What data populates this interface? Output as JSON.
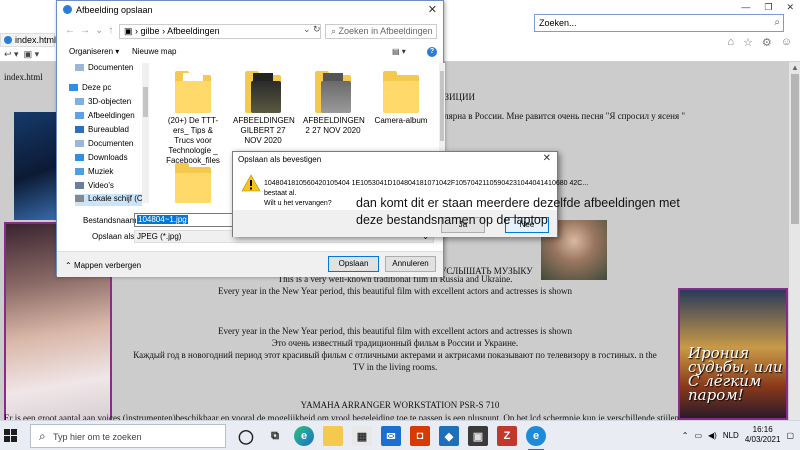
{
  "browser": {
    "tab_title": "index.html",
    "search_placeholder": "Zoeken...",
    "window_controls": [
      "—",
      "❐",
      "✕"
    ]
  },
  "page": {
    "filename_text": "index.html",
    "heading1": "ВИЗИЦИИ",
    "russian_line": "улярна в России. Мне равится очень песня \"Я спросил у ясеня \"",
    "heading2": "УСЛЫШАТЬ МУЗЫКУ",
    "para1": [
      "This is a very well-known traditional film in Russia and Ukraine.",
      "Every year in the New Year period, this beautiful film with excellent actors and actresses is shown"
    ],
    "para2": [
      "Every year in the New Year period, this beautiful film with excellent actors and actresses is shown",
      "Это очень известный традиционный фильм в России и Украине.",
      "Каждый год в новогодний период этот красивый фильм с отличными актерами и актрисами показывают по телевизору в гостиных. n the TV in the living rooms."
    ],
    "heading3": "YAMAHA ARRANGER WORKSTATION PSR-S 710",
    "last_line": "Er is een groot aantal aan voices (instrumenten)beschikbaar en vooral de mogelijkheid om vrool begeleiding toe te passen is een pluspunt. Op het lcd schermpje kun je verschillende stijlen",
    "poster_text": "Ирония судьбы, или С лёгким паром!"
  },
  "save_dialog": {
    "title": "Afbeelding opslaan",
    "path_segments": [
      "gilbe",
      "Afbeeldingen"
    ],
    "search_placeholder": "Zoeken in Afbeeldingen",
    "organise_label": "Organiseren ▾",
    "new_folder_label": "Nieuwe map",
    "tree": [
      "Documenten",
      "Deze pc",
      "3D-objecten",
      "Afbeeldingen",
      "Bureaublad",
      "Documenten",
      "Downloads",
      "Muziek",
      "Video's",
      "Lokale schijf (C:)"
    ],
    "files": [
      {
        "name": "(20+) De TTT-ers_ Tips & Trucs voor Technologie _ Facebook_files",
        "kind": "folder"
      },
      {
        "name": "AFBEELDINGEN GILBERT 27 NOV 2020",
        "kind": "folder-dark"
      },
      {
        "name": "AFBEELDINGEN 2 27 NOV 2020",
        "kind": "folder-grey"
      },
      {
        "name": "Camera-album",
        "kind": "folder"
      },
      {
        "name": "",
        "kind": "folder"
      }
    ],
    "filename_label": "Bestandsnaam:",
    "filename_value": "104804~1.jpg",
    "savetype_label": "Opslaan als:",
    "savetype_value": "JPEG (*.jpg)",
    "hide_folders_label": "Mappen verbergen",
    "save_button": "Opslaan",
    "cancel_button": "Annuleren"
  },
  "confirm_dialog": {
    "title": "Opslaan als bevestigen",
    "filename": "1048041810560420105404 1E1053041D104804181071042F10570421105904231044041410680 42C...",
    "line2": "bestaat al.",
    "line3": "Wilt u het vervangen?",
    "yes_button": "Ja",
    "no_button": "Nee"
  },
  "overlay_note": "dan komt dit er staan meerdere dezelfde afbeeldingen met deze bestandsnamen op de laptop",
  "taskbar": {
    "search_placeholder": "Typ hier om te zoeken",
    "language": "NLD",
    "time": "16:16",
    "date": "4/03/2021"
  },
  "colors": {
    "accent": "#0078d7",
    "folder": "#f4c94e",
    "warning": "#f5c518",
    "poster_border": "#8a2a8a"
  }
}
